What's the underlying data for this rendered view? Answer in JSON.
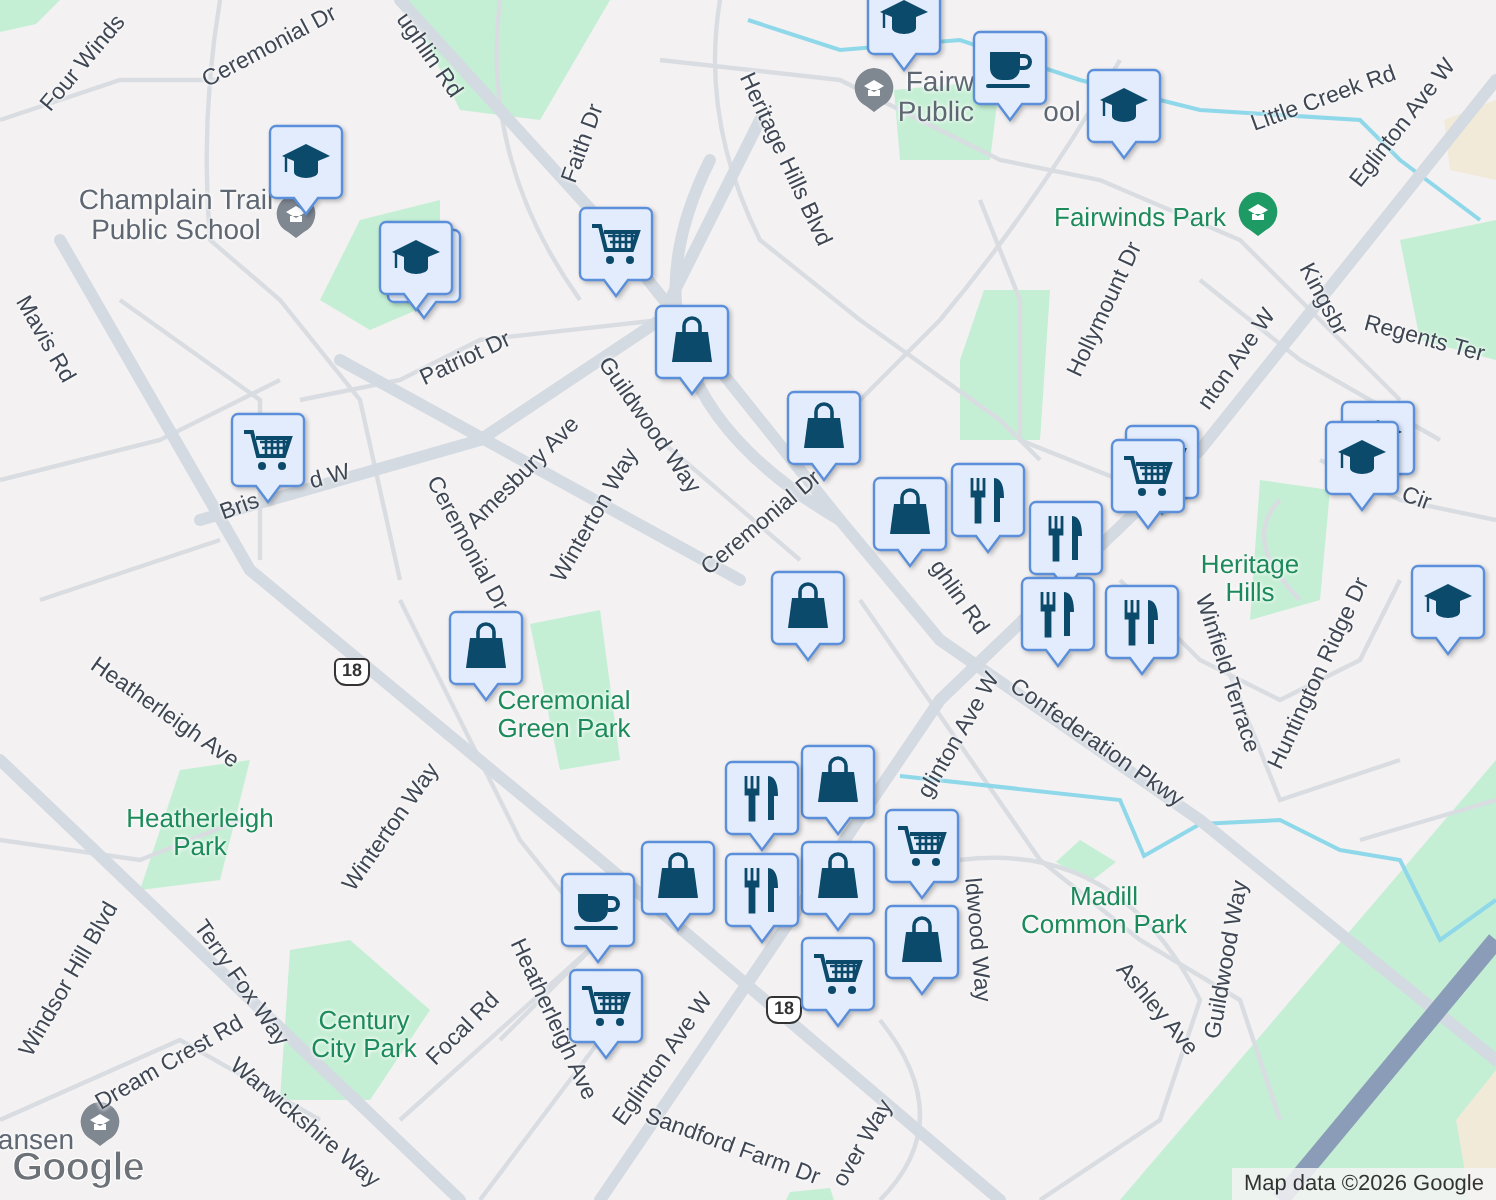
{
  "labels": [
    {
      "text": "Four Winds",
      "kind": "street"
    },
    {
      "text": "Ceremonial Dr",
      "kind": "street"
    },
    {
      "text": "ughlin Rd",
      "kind": "street"
    },
    {
      "text": "Faith Dr",
      "kind": "street"
    },
    {
      "text": "Heritage Hills Blvd",
      "kind": "street"
    },
    {
      "text": "Little Creek Rd",
      "kind": "street"
    },
    {
      "text": "Eglinton Ave W",
      "kind": "street"
    },
    {
      "text": "Hollymount Dr",
      "kind": "street"
    },
    {
      "text": "Kingsbr",
      "kind": "street"
    },
    {
      "text": "Regents Ter",
      "kind": "street"
    },
    {
      "text": "nton Ave W",
      "kind": "street"
    },
    {
      "text": "Patriot Dr",
      "kind": "street"
    },
    {
      "text": "Guildwood Way",
      "kind": "street"
    },
    {
      "text": "Amesbury Ave",
      "kind": "street"
    },
    {
      "text": "Bris",
      "kind": "street"
    },
    {
      "text": "d W",
      "kind": "street"
    },
    {
      "text": "Ceremonial Dr",
      "kind": "street"
    },
    {
      "text": "Winterton Way",
      "kind": "street"
    },
    {
      "text": "Ceremonial Dr",
      "kind": "street"
    },
    {
      "text": "ghlin Rd",
      "kind": "street"
    },
    {
      "text": "Mavis Rd",
      "kind": "street"
    },
    {
      "text": "Cir",
      "kind": "street"
    },
    {
      "text": "Winfield Terrace",
      "kind": "street"
    },
    {
      "text": "Huntington Ridge Dr",
      "kind": "street"
    },
    {
      "text": "Confederation Pkwy",
      "kind": "street"
    },
    {
      "text": "glinton Ave W",
      "kind": "street"
    },
    {
      "text": "ldwood Way",
      "kind": "street"
    },
    {
      "text": "Ashley Ave",
      "kind": "street"
    },
    {
      "text": "Guildwood Way",
      "kind": "street"
    },
    {
      "text": "Heatherleigh Ave",
      "kind": "street"
    },
    {
      "text": "Winterton Way",
      "kind": "street"
    },
    {
      "text": "Windsor Hill Blvd",
      "kind": "street"
    },
    {
      "text": "Terry Fox Way",
      "kind": "street"
    },
    {
      "text": "Focal Rd",
      "kind": "street"
    },
    {
      "text": "Heatherleigh Ave",
      "kind": "street"
    },
    {
      "text": "Dream Crest Rd",
      "kind": "street"
    },
    {
      "text": "Warwickshire Way",
      "kind": "street"
    },
    {
      "text": "Eglinton Ave W",
      "kind": "street"
    },
    {
      "text": "Sandford Farm Dr",
      "kind": "street"
    },
    {
      "text": "over Way",
      "kind": "street"
    },
    {
      "text": "Fairwinds Park",
      "kind": "park"
    },
    {
      "text": "Ceremonial\nGreen Park",
      "kind": "park"
    },
    {
      "text": "Heatherleigh\nPark",
      "kind": "park"
    },
    {
      "text": "Century\nCity Park",
      "kind": "park"
    },
    {
      "text": "Madill\nCommon Park",
      "kind": "park"
    },
    {
      "text": "Heritage\nHills",
      "kind": "park"
    },
    {
      "text": "Champlain Trail\nPublic School",
      "kind": "school"
    },
    {
      "text": "Fairw",
      "kind": "school"
    },
    {
      "text": "Public",
      "kind": "school"
    },
    {
      "text": "ool",
      "kind": "school"
    },
    {
      "text": "ansen",
      "kind": "school"
    },
    {
      "text": "18",
      "kind": "shield"
    },
    {
      "text": "18",
      "kind": "shield"
    }
  ],
  "markers": [
    {
      "kind": "school"
    },
    {
      "kind": "school"
    },
    {
      "kind": "school"
    },
    {
      "kind": "cart"
    },
    {
      "kind": "bag"
    },
    {
      "kind": "cart"
    },
    {
      "kind": "school"
    },
    {
      "kind": "cup"
    },
    {
      "kind": "school"
    },
    {
      "kind": "bag"
    },
    {
      "kind": "bag"
    },
    {
      "kind": "food"
    },
    {
      "kind": "cart"
    },
    {
      "kind": "cart"
    },
    {
      "kind": "school"
    },
    {
      "kind": "school"
    },
    {
      "kind": "food"
    },
    {
      "kind": "food"
    },
    {
      "kind": "food"
    },
    {
      "kind": "school"
    },
    {
      "kind": "bag"
    },
    {
      "kind": "bag"
    },
    {
      "kind": "bag"
    },
    {
      "kind": "cart"
    },
    {
      "kind": "bag"
    },
    {
      "kind": "food"
    },
    {
      "kind": "bag"
    },
    {
      "kind": "cart"
    },
    {
      "kind": "food"
    },
    {
      "kind": "cup"
    },
    {
      "kind": "bag"
    },
    {
      "kind": "cart"
    }
  ],
  "logo": "Google",
  "attribution": "Map data ©2026 Google"
}
